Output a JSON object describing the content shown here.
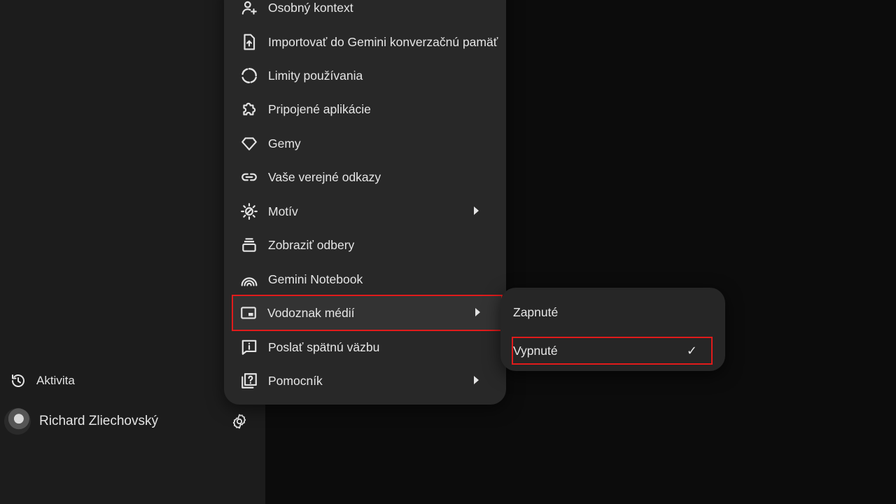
{
  "menu": {
    "items": [
      {
        "label": "Osobný kontext",
        "icon": "person-sparkle-icon"
      },
      {
        "label": "Importovať do Gemini konverzačnú pamäť",
        "icon": "file-upload-icon"
      },
      {
        "label": "Limity používania",
        "icon": "dashed-circle-icon"
      },
      {
        "label": "Pripojené aplikácie",
        "icon": "puzzle-icon"
      },
      {
        "label": "Gemy",
        "icon": "gem-icon"
      },
      {
        "label": "Vaše verejné odkazy",
        "icon": "link-icon"
      },
      {
        "label": "Motív",
        "icon": "theme-sun-icon"
      },
      {
        "label": "Zobraziť odbery",
        "icon": "subscriptions-icon"
      },
      {
        "label": "Gemini Notebook",
        "icon": "notebook-arcs-icon"
      },
      {
        "label": "Vodoznak médií",
        "icon": "watermark-icon"
      },
      {
        "label": "Poslať spätnú väzbu",
        "icon": "feedback-icon"
      },
      {
        "label": "Pomocník",
        "icon": "help-icon"
      }
    ]
  },
  "submenu": {
    "options": [
      {
        "label": "Zapnuté",
        "selected": false
      },
      {
        "label": "Vypnuté",
        "selected": true
      }
    ],
    "check_glyph": "✓"
  },
  "sidebar": {
    "activity_label": "Aktivita",
    "user_name": "Richard Zliechovský"
  },
  "colors": {
    "highlight_border": "#e01b1b",
    "menu_bg": "#282828",
    "sidebar_bg": "#1c1c1c",
    "page_bg": "#0c0c0c"
  }
}
